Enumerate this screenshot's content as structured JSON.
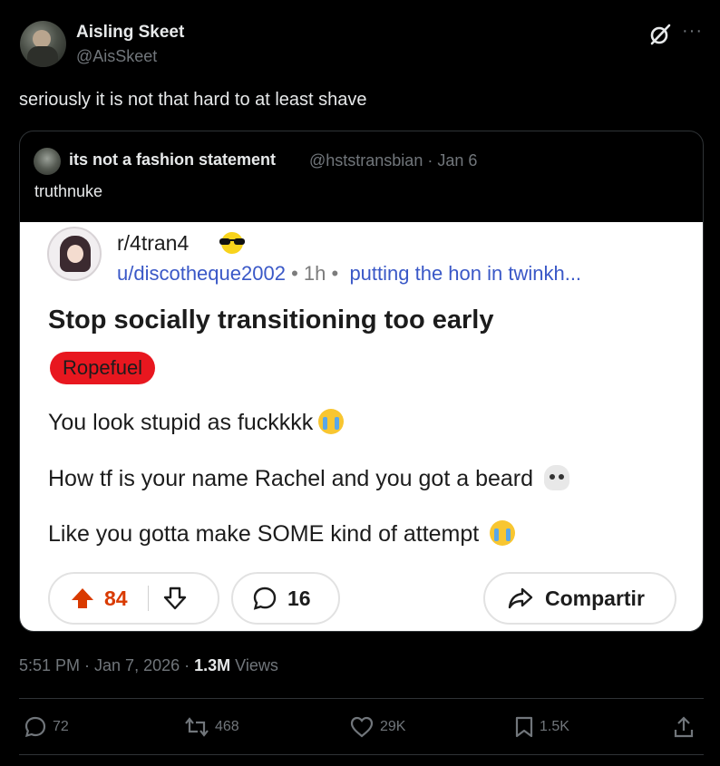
{
  "author": {
    "name": "Aisling Skeet",
    "handle": "@AisSkeet",
    "avatar_icon": "user-avatar"
  },
  "tweet_text": "seriously it is not that hard to at least shave",
  "quote": {
    "name": "its not a fashion statement",
    "meta": "@hststransbian · Jan 6",
    "text": "truthnuke",
    "image": {
      "subreddit": "r/4tran4",
      "user": "u/discotheque2002",
      "time": "1h",
      "user_flair": "putting the hon in twinkh...",
      "title": "Stop socially transitioning too early",
      "flair": "Ropefuel",
      "lines": [
        "You look stupid as fuckkkk",
        "How tf is your name Rachel and you got a beard",
        "Like you gotta make SOME kind of attempt"
      ],
      "upvotes": "84",
      "comments": "16",
      "share_label": "Compartir"
    }
  },
  "meta": {
    "time": "5:51 PM · Jan 7, 2026 · ",
    "views_count": "1.3M",
    "views_label": " Views"
  },
  "actions": {
    "replies": "72",
    "reposts": "468",
    "likes": "29K",
    "bookmarks": "1.5K"
  },
  "colors": {
    "background": "#000000",
    "muted": "#71767b",
    "reddit_link": "#3a58c7",
    "upvote": "#d93a00",
    "flair": "#e8171f"
  }
}
